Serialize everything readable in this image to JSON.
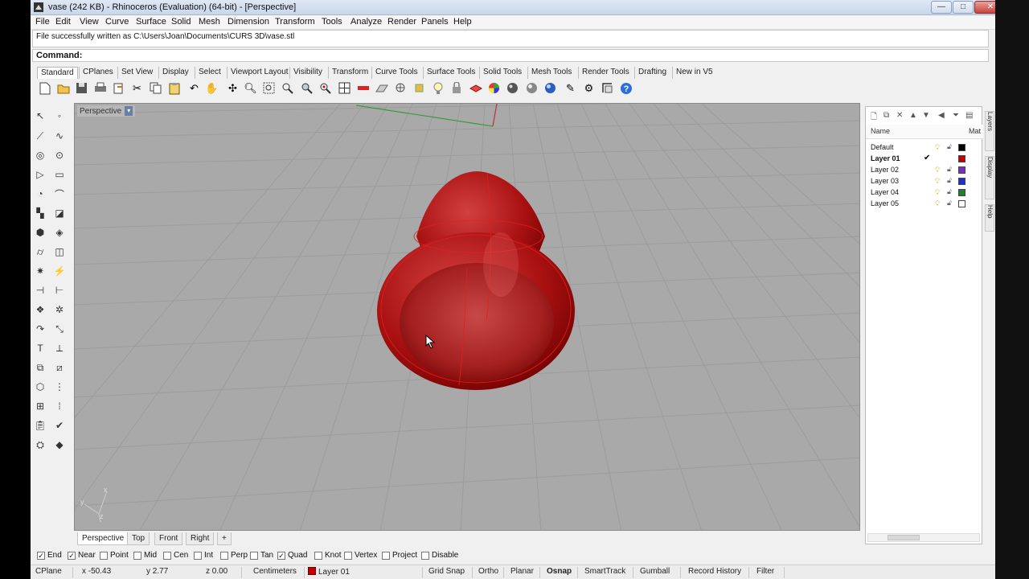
{
  "window": {
    "title": "vase (242 KB) - Rhinoceros (Evaluation) (64-bit) - [Perspective]",
    "minimize": "—",
    "maximize": "□",
    "close": "✕"
  },
  "menu": [
    "File",
    "Edit",
    "View",
    "Curve",
    "Surface",
    "Solid",
    "Mesh",
    "Dimension",
    "Transform",
    "Tools",
    "Analyze",
    "Render",
    "Panels",
    "Help"
  ],
  "command_history": "File successfully written as C:\\Users\\Joan\\Documents\\CURS 3D\\vase.stl",
  "command_prompt": "Command:",
  "toolbar_tabs": [
    "Standard",
    "CPlanes",
    "Set View",
    "Display",
    "Select",
    "Viewport Layout",
    "Visibility",
    "Transform",
    "Curve Tools",
    "Surface Tools",
    "Solid Tools",
    "Mesh Tools",
    "Render Tools",
    "Drafting",
    "New in V5"
  ],
  "viewport": {
    "label": "Perspective",
    "dropdown": "▾",
    "axis_x": "x",
    "axis_y": "y",
    "axis_z": "z"
  },
  "viewport_tabs": [
    "Perspective",
    "Top",
    "Front",
    "Right",
    "+"
  ],
  "layers": {
    "col_name": "Name",
    "col_material": "Mat",
    "rows": [
      {
        "name": "Default",
        "current": false,
        "color": "#000000"
      },
      {
        "name": "Layer 01",
        "current": true,
        "color": "#c00000"
      },
      {
        "name": "Layer 02",
        "current": false,
        "color": "#7b2fbf"
      },
      {
        "name": "Layer 03",
        "current": false,
        "color": "#1f2fcf"
      },
      {
        "name": "Layer 04",
        "current": false,
        "color": "#1f7f2f"
      },
      {
        "name": "Layer 05",
        "current": false,
        "color": "#ffffff"
      }
    ],
    "checkmark": "✔",
    "side_tabs": [
      "Layers",
      "Display",
      "Help"
    ]
  },
  "osnaps": [
    {
      "label": "End",
      "checked": true
    },
    {
      "label": "Near",
      "checked": true
    },
    {
      "label": "Point",
      "checked": false
    },
    {
      "label": "Mid",
      "checked": false
    },
    {
      "label": "Cen",
      "checked": false
    },
    {
      "label": "Int",
      "checked": false
    },
    {
      "label": "Perp",
      "checked": false
    },
    {
      "label": "Tan",
      "checked": false
    },
    {
      "label": "Quad",
      "checked": true
    },
    {
      "label": "Knot",
      "checked": false
    },
    {
      "label": "Vertex",
      "checked": false
    },
    {
      "label": "Project",
      "checked": false
    },
    {
      "label": "Disable",
      "checked": false
    }
  ],
  "status": {
    "cplane": "CPlane",
    "x": "x -50.43",
    "y": "y 2.77",
    "z": "z 0.00",
    "units": "Centimeters",
    "layer": "Layer 01",
    "grid_snap": "Grid Snap",
    "ortho": "Ortho",
    "planar": "Planar",
    "osnap": "Osnap",
    "smarttrack": "SmartTrack",
    "gumball": "Gumball",
    "record_history": "Record History",
    "filter": "Filter"
  },
  "colors": {
    "viewport_bg": "#a9a9a9",
    "object_red": "#c00000",
    "current_layer": "#c00000"
  }
}
